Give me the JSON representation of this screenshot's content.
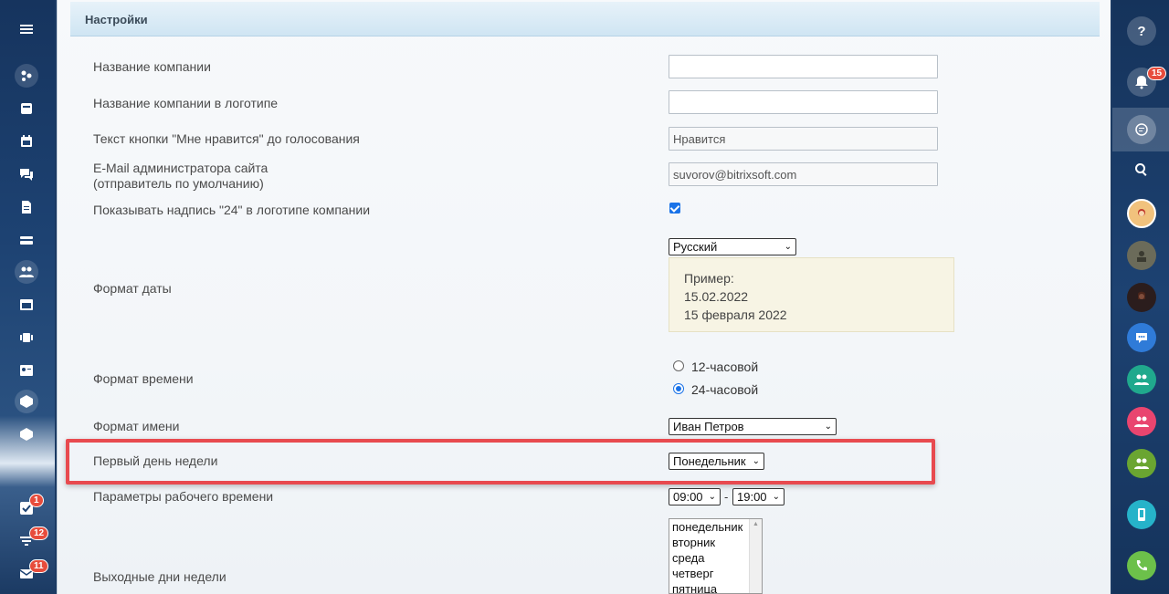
{
  "section": {
    "title": "Настройки"
  },
  "fields": {
    "company_name": {
      "label": "Название компании",
      "value": ""
    },
    "company_logo_name": {
      "label": "Название компании в логотипе",
      "value": ""
    },
    "like_button": {
      "label": "Текст кнопки \"Мне нравится\" до голосования",
      "value": "Нравится"
    },
    "admin_email": {
      "label_line1": "E-Mail администратора сайта",
      "label_line2": "(отправитель по умолчанию)",
      "value": "suvorov@bitrixsoft.com"
    },
    "show_24": {
      "label": "Показывать надпись \"24\" в логотипе компании",
      "checked": true
    },
    "date_format": {
      "label": "Формат даты",
      "selected": "Русский",
      "example_title": "Пример:",
      "example_short": "15.02.2022",
      "example_long": "15 февраля 2022"
    },
    "time_format": {
      "label": "Формат времени",
      "options": [
        "12-часовой",
        "24-часовой"
      ],
      "selected": "24-часовой"
    },
    "name_format": {
      "label": "Формат имени",
      "selected": "Иван Петров"
    },
    "first_day": {
      "label": "Первый день недели",
      "selected": "Понедельник"
    },
    "work_time": {
      "label": "Параметры рабочего времени",
      "start": "09:00",
      "separator": "-",
      "end": "19:00"
    },
    "weekends": {
      "label": "Выходные дни недели",
      "options": [
        "понедельник",
        "вторник",
        "среда",
        "четверг",
        "пятница"
      ]
    }
  },
  "left_sidebar": {
    "badges": {
      "tasks": "1",
      "filters": "12",
      "mail": "11"
    }
  },
  "right_sidebar": {
    "notifications_badge": "15"
  },
  "colors": {
    "accent": "#1a73e8",
    "highlight": "#e84a4f",
    "badge": "#e74c3c"
  }
}
